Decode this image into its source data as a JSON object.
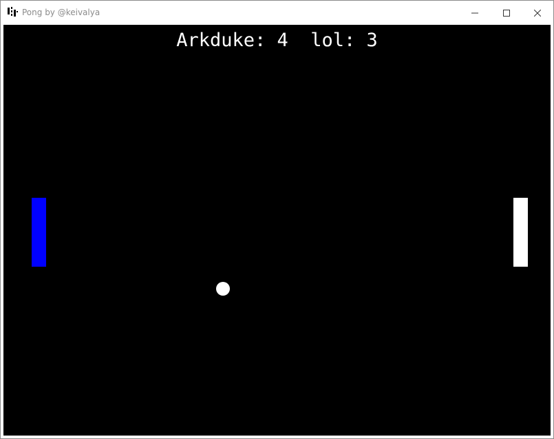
{
  "window": {
    "title": "Pong by @keivalya",
    "icon": "pong-app-icon",
    "controls": {
      "minimize_icon": "minimize-icon",
      "maximize_icon": "maximize-icon",
      "close_icon": "close-icon"
    }
  },
  "game": {
    "background_color": "#000000",
    "players": [
      {
        "name": "Arkduke",
        "score": 4,
        "paddle_color": "#0000ff"
      },
      {
        "name": "lol",
        "score": 3,
        "paddle_color": "#ffffff"
      }
    ],
    "scoreboard_text": "Arkduke: 4  lol: 3",
    "ball_color": "#ffffff"
  }
}
